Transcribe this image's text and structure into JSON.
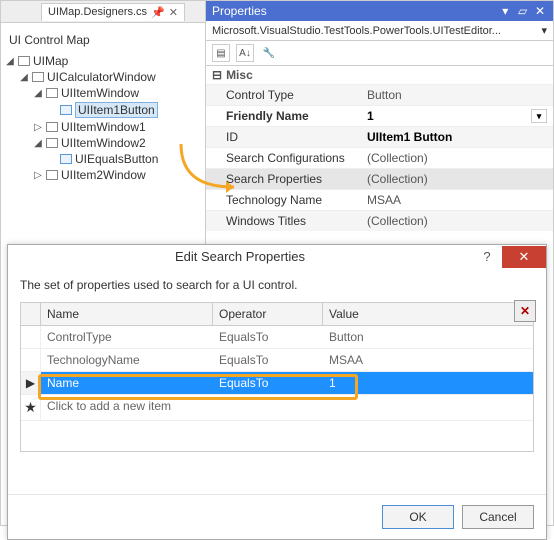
{
  "tab": {
    "filename": "UIMap.Designers.cs"
  },
  "tree": {
    "title": "UI Control Map",
    "root": "UIMap",
    "n1": "UICalculatorWindow",
    "n2": "UIItemWindow",
    "n3": "UIItem1Button",
    "n4": "UIItemWindow1",
    "n5": "UIItemWindow2",
    "n6": "UIEqualsButton",
    "n7": "UIItem2Window"
  },
  "props": {
    "panelTitle": "Properties",
    "subtitle": "Microsoft.VisualStudio.TestTools.PowerTools.UITestEditor...",
    "category": "Misc",
    "rows": {
      "controlType": {
        "label": "Control Type",
        "value": "Button"
      },
      "friendlyName": {
        "label": "Friendly Name",
        "value": "1"
      },
      "id": {
        "label": "ID",
        "value": "UIItem1 Button"
      },
      "searchConfig": {
        "label": "Search Configurations",
        "value": "(Collection)"
      },
      "searchProps": {
        "label": "Search Properties",
        "value": "(Collection)"
      },
      "techName": {
        "label": "Technology Name",
        "value": "MSAA"
      },
      "winTitles": {
        "label": "Windows Titles",
        "value": "(Collection)"
      }
    }
  },
  "dialog": {
    "title": "Edit Search Properties",
    "description": "The set of properties used to search for a UI control.",
    "columns": {
      "c1": "Name",
      "c2": "Operator",
      "c3": "Value"
    },
    "rows": {
      "r1": {
        "name": "ControlType",
        "op": "EqualsTo",
        "val": "Button"
      },
      "r2": {
        "name": "TechnologyName",
        "op": "EqualsTo",
        "val": "MSAA"
      },
      "r3": {
        "name": "Name",
        "op": "EqualsTo",
        "val": "1"
      }
    },
    "addItem": "Click to add a new item",
    "ok": "OK",
    "cancel": "Cancel",
    "deleteGlyph": "✕",
    "help": "?",
    "close": "✕"
  }
}
